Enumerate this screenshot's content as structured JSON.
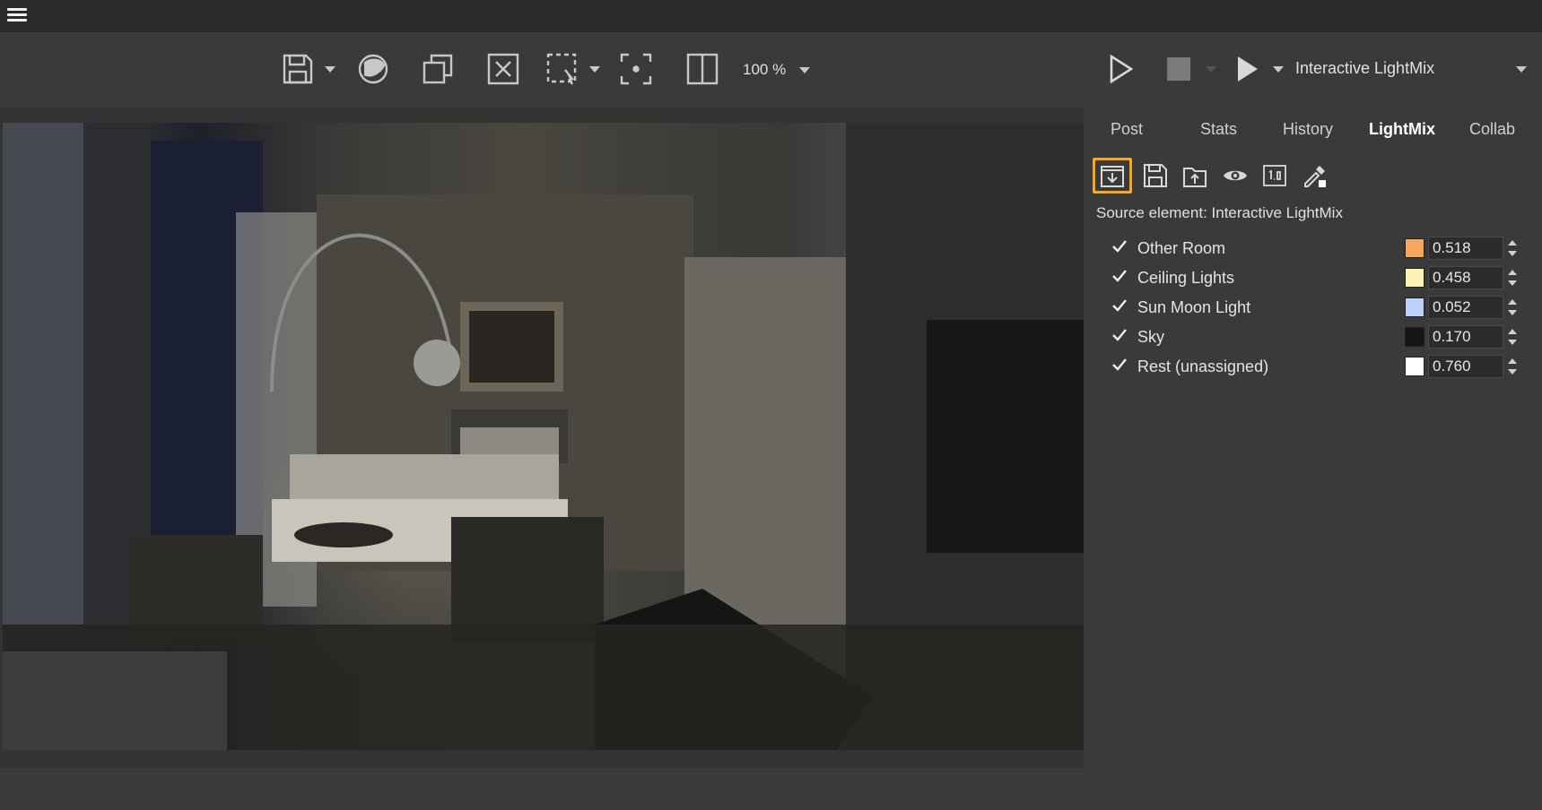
{
  "toolbar": {
    "zoom_label": "100 %",
    "source_dropdown_label": "Interactive LightMix"
  },
  "panel": {
    "tabs": [
      {
        "label": "Post"
      },
      {
        "label": "Stats"
      },
      {
        "label": "History"
      },
      {
        "label": "LightMix"
      },
      {
        "label": "Collab"
      }
    ],
    "active_tab": "LightMix",
    "source_element_text": "Source element: Interactive LightMix",
    "lights": [
      {
        "name": "Other Room",
        "checked": true,
        "color": "#f6a75c",
        "value": "0.518"
      },
      {
        "name": "Ceiling Lights",
        "checked": true,
        "color": "#fbf2b4",
        "value": "0.458"
      },
      {
        "name": "Sun Moon Light",
        "checked": true,
        "color": "#bcd2f8",
        "value": "0.052"
      },
      {
        "name": "Sky",
        "checked": true,
        "color": "#141414",
        "value": "0.170"
      },
      {
        "name": "Rest (unassigned)",
        "checked": true,
        "color": "#ffffff",
        "value": "0.760"
      }
    ]
  },
  "colors": {
    "accent": "#f5a623",
    "topbar_bg": "#2a2a2a",
    "panel_bg": "#3a3a3a"
  }
}
